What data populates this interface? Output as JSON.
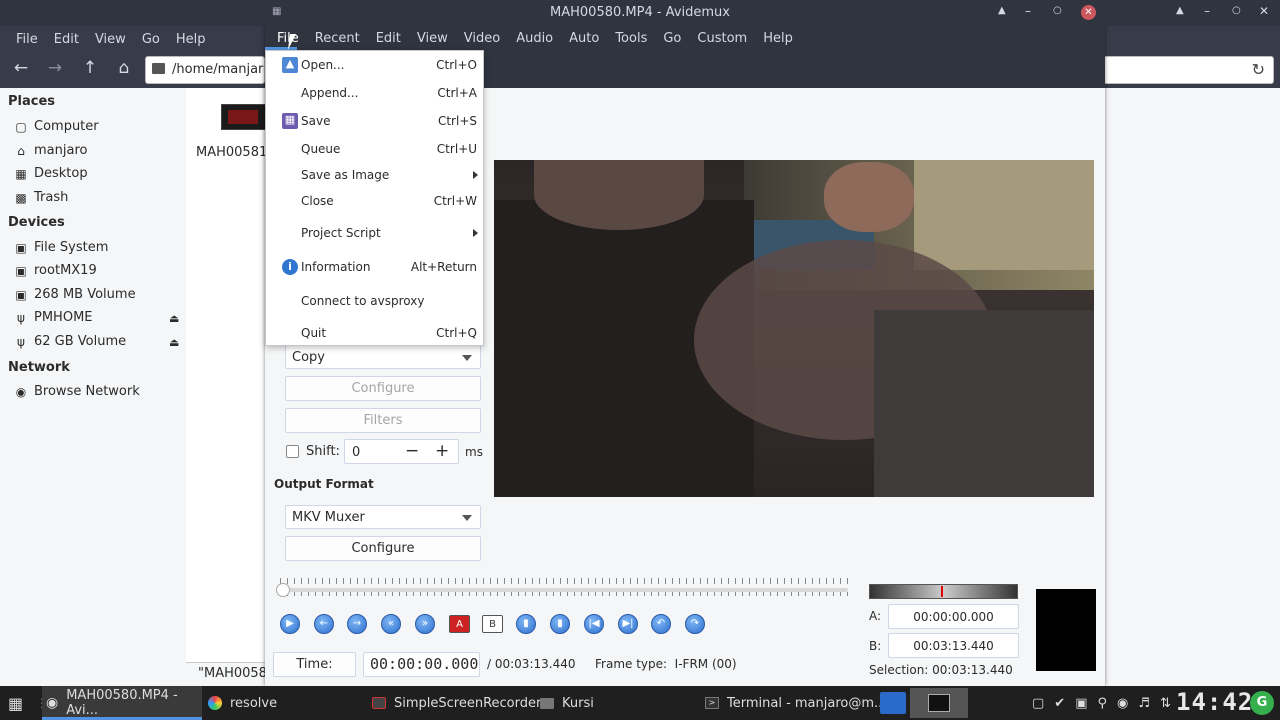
{
  "file_manager": {
    "menu": [
      "File",
      "Edit",
      "View",
      "Go",
      "Help"
    ],
    "path": "/home/manjaro/",
    "places_header": "Places",
    "places": [
      {
        "label": "Computer",
        "icon": "computer-icon"
      },
      {
        "label": "manjaro",
        "icon": "home-icon"
      },
      {
        "label": "Desktop",
        "icon": "desktop-icon"
      },
      {
        "label": "Trash",
        "icon": "trash-icon"
      }
    ],
    "devices_header": "Devices",
    "devices": [
      {
        "label": "File System",
        "icon": "drive-icon"
      },
      {
        "label": "rootMX19",
        "icon": "drive-icon"
      },
      {
        "label": "268 MB Volume",
        "icon": "drive-icon"
      },
      {
        "label": "PMHOME",
        "icon": "usb-icon",
        "eject": true
      },
      {
        "label": "62 GB Volume",
        "icon": "usb-icon",
        "eject": true
      }
    ],
    "network_header": "Network",
    "network": [
      {
        "label": "Browse Network",
        "icon": "network-icon"
      }
    ],
    "file_item": "MAH00581",
    "status": "\"MAH0058"
  },
  "avidemux": {
    "title": "MAH00580.MP4 - Avidemux",
    "menu": [
      "File",
      "Recent",
      "Edit",
      "View",
      "Video",
      "Audio",
      "Auto",
      "Tools",
      "Go",
      "Custom",
      "Help"
    ],
    "file_menu": [
      {
        "label": "Open...",
        "shortcut": "Ctrl+O",
        "icon": "open-icon"
      },
      {
        "label": "Append...",
        "shortcut": "Ctrl+A"
      },
      {
        "label": "Save",
        "shortcut": "Ctrl+S",
        "icon": "save-icon"
      },
      {
        "label": "Queue",
        "shortcut": "Ctrl+U"
      },
      {
        "label": "Save as Image",
        "shortcut": "",
        "submenu": true
      },
      {
        "label": "Close",
        "shortcut": "Ctrl+W"
      },
      {
        "label": "Project Script",
        "shortcut": "",
        "submenu": true
      },
      {
        "label": "Information",
        "shortcut": "Alt+Return",
        "icon": "info-icon"
      },
      {
        "label": "Connect to avsproxy",
        "shortcut": ""
      },
      {
        "label": "Quit",
        "shortcut": "Ctrl+Q"
      }
    ],
    "audio_codec": "Copy",
    "audio_configure": "Configure",
    "audio_filters": "Filters",
    "shift_label": "Shift:",
    "shift_value": "0",
    "shift_unit": "ms",
    "output_format_label": "Output Format",
    "output_format": "MKV Muxer",
    "output_configure": "Configure",
    "time_label": "Time:",
    "time_value": "00:00:00.000",
    "duration": "/ 00:03:13.440",
    "frame_type": "Frame type:  I-FRM (00)",
    "a_label": "A:",
    "a_value": "00:00:00.000",
    "b_label": "B:",
    "b_value": "00:03:13.440",
    "selection": "Selection: 00:03:13.440"
  },
  "taskbar": {
    "items": [
      {
        "label": "MAH00580.MP4 - Avi...",
        "icon": "avidemux-icon",
        "active": true
      },
      {
        "label": "resolve",
        "icon": "resolve-icon"
      },
      {
        "label": "SimpleScreenRecorder",
        "icon": "recorder-icon"
      },
      {
        "label": "Kursi",
        "icon": "folder-icon"
      },
      {
        "label": "Terminal - manjaro@m...",
        "icon": "terminal-icon"
      }
    ],
    "clock": "14:42"
  }
}
